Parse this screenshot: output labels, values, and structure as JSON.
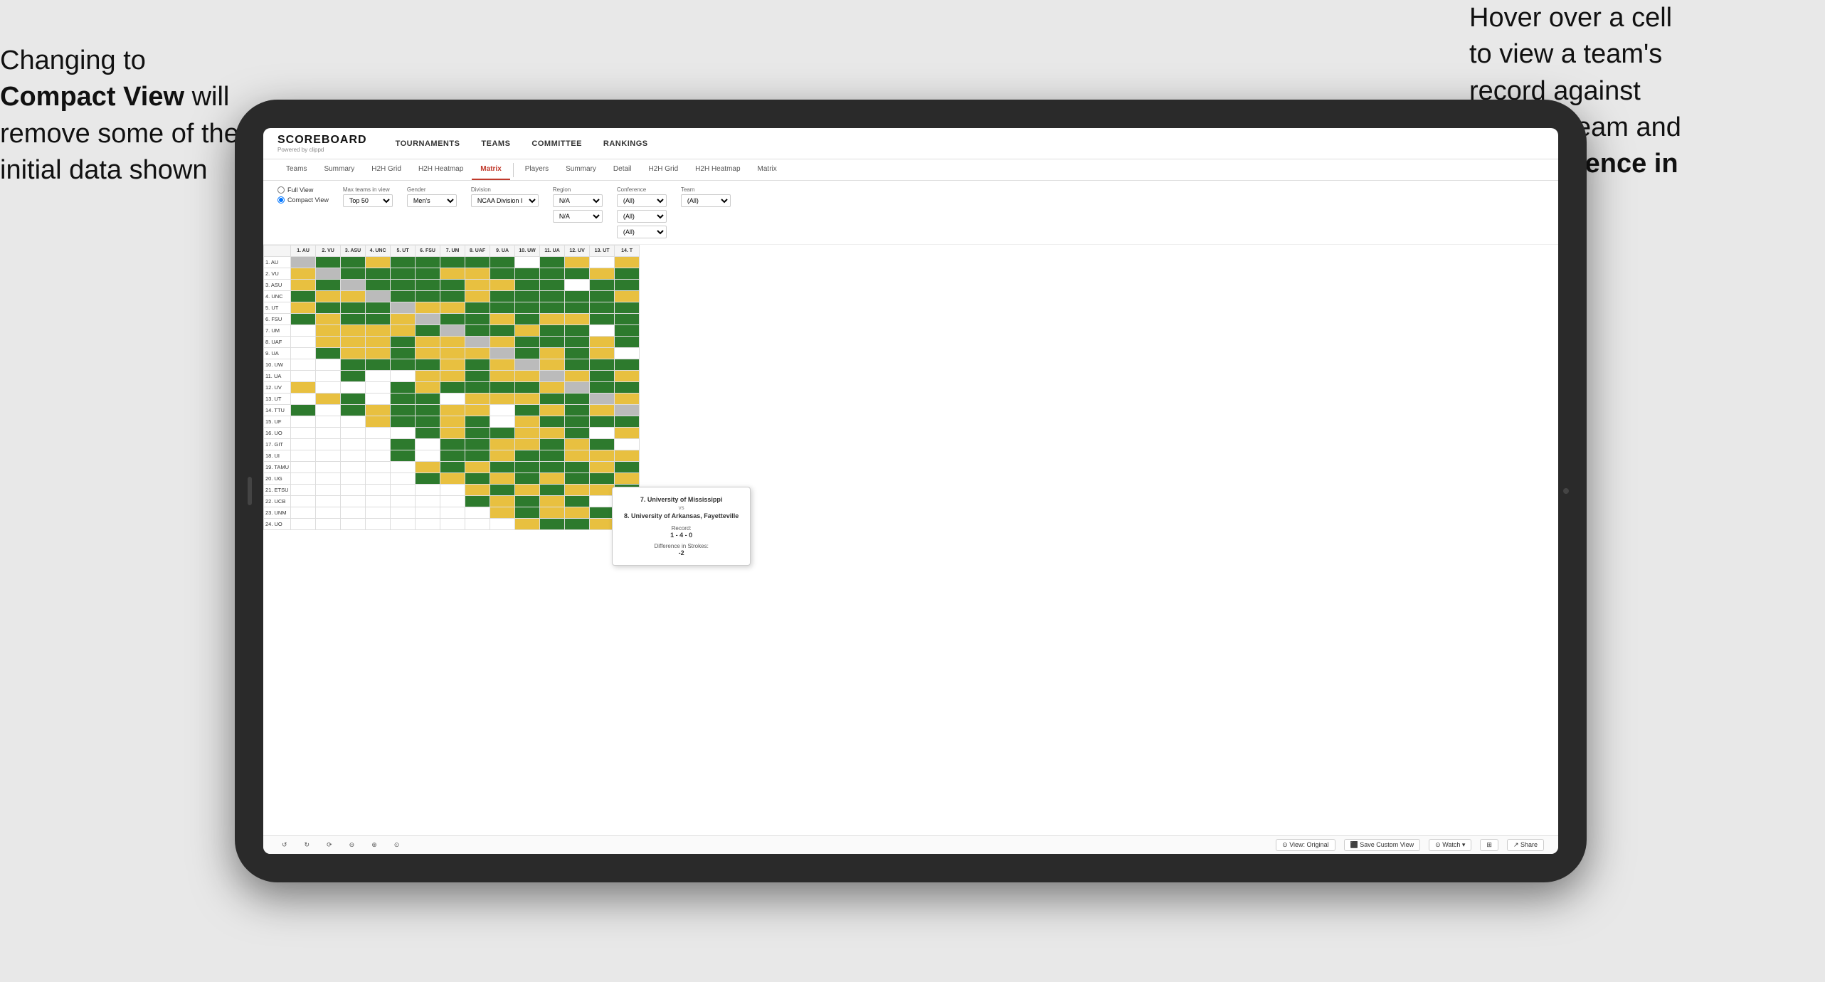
{
  "annotations": {
    "left_title": "Changing to",
    "left_bold": "Compact View",
    "left_text": " will\nremove some of the\ninitial data shown",
    "right_text": "Hover over a cell\nto view a team's\nrecord against\nanother team and\nthe ",
    "right_bold": "Difference in\nStrokes"
  },
  "nav": {
    "logo": "SCOREBOARD",
    "logo_sub": "Powered by clippd",
    "items": [
      "TOURNAMENTS",
      "TEAMS",
      "COMMITTEE",
      "RANKINGS"
    ]
  },
  "sub_nav": {
    "teams_items": [
      "Teams",
      "Summary",
      "H2H Grid",
      "H2H Heatmap",
      "Matrix"
    ],
    "players_items": [
      "Players",
      "Summary",
      "Detail",
      "H2H Grid",
      "H2H Heatmap",
      "Matrix"
    ],
    "active": "Matrix"
  },
  "filters": {
    "view_full": "Full View",
    "view_compact": "Compact View",
    "compact_selected": true,
    "max_teams_label": "Max teams in view",
    "max_teams_val": "Top 50",
    "gender_label": "Gender",
    "gender_val": "Men's",
    "division_label": "Division",
    "division_val": "NCAA Division I",
    "region_label": "Region",
    "region_val": "N/A",
    "conference_label": "Conference",
    "conference_vals": [
      "(All)",
      "(All)",
      "(All)"
    ],
    "team_label": "Team",
    "team_val": "(All)"
  },
  "matrix": {
    "col_headers": [
      "1. AU",
      "2. VU",
      "3. ASU",
      "4. UNC",
      "5. UT",
      "6. FSU",
      "7. UM",
      "8. UAF",
      "9. UA",
      "10. UW",
      "11. UA",
      "12. UV",
      "13. UT",
      "14. T"
    ],
    "rows": [
      {
        "label": "1. AU",
        "cells": [
          "diag",
          "green",
          "green",
          "yellow",
          "green",
          "green",
          "green",
          "green",
          "green",
          "white",
          "green",
          "yellow",
          "white",
          "yellow"
        ]
      },
      {
        "label": "2. VU",
        "cells": [
          "yellow",
          "diag",
          "green",
          "green",
          "green",
          "green",
          "yellow",
          "yellow",
          "green",
          "green",
          "green",
          "green",
          "yellow",
          "green"
        ]
      },
      {
        "label": "3. ASU",
        "cells": [
          "yellow",
          "green",
          "diag",
          "green",
          "green",
          "green",
          "green",
          "yellow",
          "yellow",
          "green",
          "green",
          "white",
          "green",
          "green"
        ]
      },
      {
        "label": "4. UNC",
        "cells": [
          "green",
          "yellow",
          "yellow",
          "diag",
          "green",
          "green",
          "green",
          "yellow",
          "green",
          "green",
          "green",
          "green",
          "green",
          "yellow"
        ]
      },
      {
        "label": "5. UT",
        "cells": [
          "yellow",
          "green",
          "green",
          "green",
          "diag",
          "yellow",
          "yellow",
          "green",
          "green",
          "green",
          "green",
          "green",
          "green",
          "green"
        ]
      },
      {
        "label": "6. FSU",
        "cells": [
          "green",
          "yellow",
          "green",
          "green",
          "yellow",
          "diag",
          "green",
          "green",
          "yellow",
          "green",
          "yellow",
          "yellow",
          "green",
          "green"
        ]
      },
      {
        "label": "7. UM",
        "cells": [
          "white",
          "yellow",
          "yellow",
          "yellow",
          "yellow",
          "green",
          "diag",
          "green",
          "green",
          "yellow",
          "green",
          "green",
          "white",
          "green"
        ]
      },
      {
        "label": "8. UAF",
        "cells": [
          "white",
          "yellow",
          "yellow",
          "yellow",
          "green",
          "yellow",
          "yellow",
          "diag",
          "yellow",
          "green",
          "green",
          "green",
          "yellow",
          "green"
        ]
      },
      {
        "label": "9. UA",
        "cells": [
          "white",
          "green",
          "yellow",
          "yellow",
          "green",
          "yellow",
          "yellow",
          "yellow",
          "diag",
          "green",
          "yellow",
          "green",
          "yellow",
          "white"
        ]
      },
      {
        "label": "10. UW",
        "cells": [
          "white",
          "white",
          "green",
          "green",
          "green",
          "green",
          "yellow",
          "green",
          "yellow",
          "diag",
          "yellow",
          "green",
          "green",
          "green"
        ]
      },
      {
        "label": "11. UA",
        "cells": [
          "white",
          "white",
          "green",
          "white",
          "white",
          "yellow",
          "yellow",
          "green",
          "yellow",
          "yellow",
          "diag",
          "yellow",
          "green",
          "yellow"
        ]
      },
      {
        "label": "12. UV",
        "cells": [
          "yellow",
          "white",
          "white",
          "white",
          "green",
          "yellow",
          "green",
          "green",
          "green",
          "green",
          "yellow",
          "diag",
          "green",
          "green"
        ]
      },
      {
        "label": "13. UT",
        "cells": [
          "white",
          "yellow",
          "green",
          "white",
          "green",
          "green",
          "white",
          "yellow",
          "yellow",
          "yellow",
          "green",
          "green",
          "diag",
          "yellow"
        ]
      },
      {
        "label": "14. TTU",
        "cells": [
          "green",
          "white",
          "green",
          "yellow",
          "green",
          "green",
          "yellow",
          "yellow",
          "white",
          "green",
          "yellow",
          "green",
          "yellow",
          "diag"
        ]
      },
      {
        "label": "15. UF",
        "cells": [
          "white",
          "white",
          "white",
          "yellow",
          "green",
          "green",
          "yellow",
          "green",
          "white",
          "yellow",
          "green",
          "green",
          "green",
          "green"
        ]
      },
      {
        "label": "16. UO",
        "cells": [
          "white",
          "white",
          "white",
          "white",
          "white",
          "green",
          "yellow",
          "green",
          "green",
          "yellow",
          "yellow",
          "green",
          "white",
          "yellow"
        ]
      },
      {
        "label": "17. GIT",
        "cells": [
          "white",
          "white",
          "white",
          "white",
          "green",
          "white",
          "green",
          "green",
          "yellow",
          "yellow",
          "green",
          "yellow",
          "green",
          "white"
        ]
      },
      {
        "label": "18. UI",
        "cells": [
          "white",
          "white",
          "white",
          "white",
          "green",
          "white",
          "green",
          "green",
          "yellow",
          "green",
          "green",
          "yellow",
          "yellow",
          "yellow"
        ]
      },
      {
        "label": "19. TAMU",
        "cells": [
          "white",
          "white",
          "white",
          "white",
          "white",
          "yellow",
          "green",
          "yellow",
          "green",
          "green",
          "green",
          "green",
          "yellow",
          "green"
        ]
      },
      {
        "label": "20. UG",
        "cells": [
          "white",
          "white",
          "white",
          "white",
          "white",
          "green",
          "yellow",
          "green",
          "yellow",
          "green",
          "yellow",
          "green",
          "green",
          "yellow"
        ]
      },
      {
        "label": "21. ETSU",
        "cells": [
          "white",
          "white",
          "white",
          "white",
          "white",
          "white",
          "white",
          "yellow",
          "green",
          "yellow",
          "green",
          "yellow",
          "yellow",
          "green"
        ]
      },
      {
        "label": "22. UCB",
        "cells": [
          "white",
          "white",
          "white",
          "white",
          "white",
          "white",
          "white",
          "green",
          "yellow",
          "green",
          "yellow",
          "green",
          "white",
          "yellow"
        ]
      },
      {
        "label": "23. UNM",
        "cells": [
          "white",
          "white",
          "white",
          "white",
          "white",
          "white",
          "white",
          "white",
          "yellow",
          "green",
          "yellow",
          "yellow",
          "green",
          "green"
        ]
      },
      {
        "label": "24. UO",
        "cells": [
          "white",
          "white",
          "white",
          "white",
          "white",
          "white",
          "white",
          "white",
          "white",
          "yellow",
          "green",
          "green",
          "yellow",
          "yellow"
        ]
      }
    ]
  },
  "tooltip": {
    "team1": "7. University of Mississippi",
    "vs": "vs",
    "team2": "8. University of Arkansas, Fayetteville",
    "record_label": "Record:",
    "record_val": "1 - 4 - 0",
    "diff_label": "Difference in Strokes:",
    "diff_val": "-2"
  },
  "toolbar": {
    "undo": "↺",
    "redo": "↻",
    "view_original": "View: Original",
    "save_custom": "Save Custom View",
    "watch": "Watch",
    "share": "Share"
  }
}
